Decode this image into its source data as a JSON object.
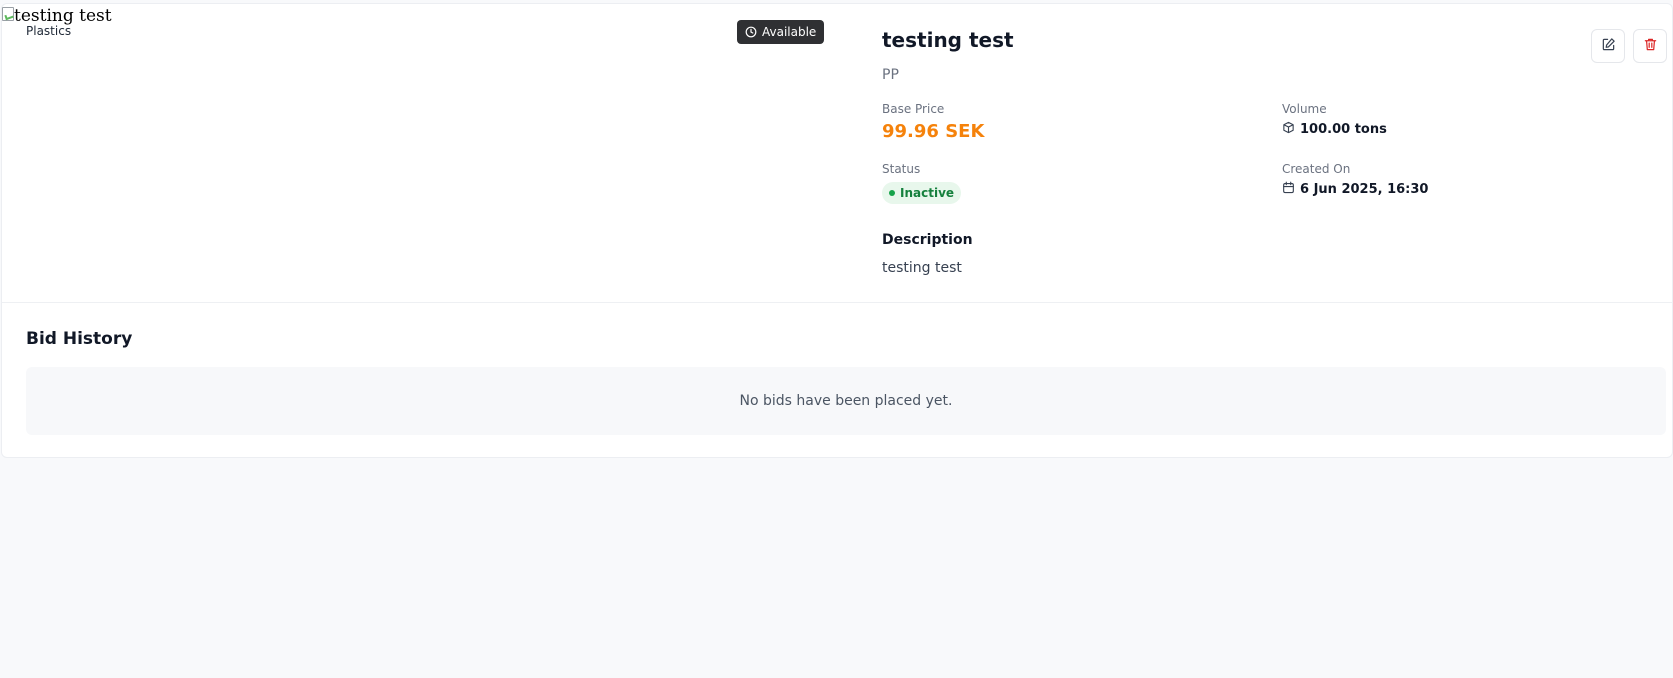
{
  "listing": {
    "image_alt": "testing test",
    "category": "Plastics",
    "availability": "Available",
    "title": "testing test",
    "material_code": "PP",
    "base_price_label": "Base Price",
    "base_price": "99.96 SEK",
    "volume_label": "Volume",
    "volume": "100.00 tons",
    "status_label": "Status",
    "status": "Inactive",
    "created_label": "Created On",
    "created_on": "6 Jun 2025, 16:30",
    "description_heading": "Description",
    "description": "testing test"
  },
  "bids": {
    "heading": "Bid History",
    "empty_message": "No bids have been placed yet."
  },
  "colors": {
    "price": "#f5820b",
    "status_text": "#15803d",
    "status_bg": "#e8f7ec",
    "delete_icon": "#dc2626",
    "badge_bg": "#2f3033"
  },
  "icons": {
    "availability": "clock-icon",
    "volume": "box-icon",
    "created": "calendar-icon",
    "edit": "edit-icon",
    "delete": "trash-icon"
  }
}
